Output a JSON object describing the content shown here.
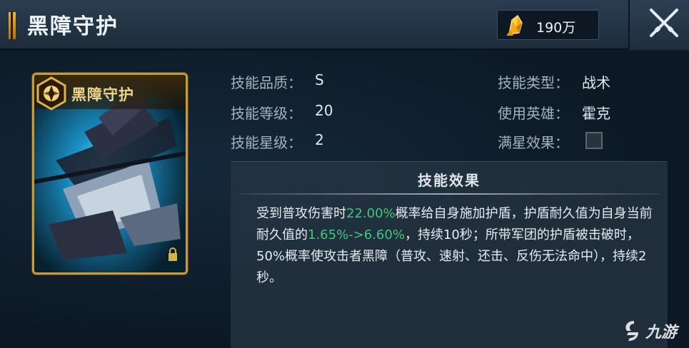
{
  "header": {
    "title": "黑障守护",
    "currency_icon": "gold-crystal-icon",
    "currency_value": "190万",
    "close_icon": "close-icon"
  },
  "card": {
    "title": "黑障守护",
    "badge_icon": "hexagon-aperture-icon",
    "art": "mech-wing-art",
    "lock_icon": "lock-icon"
  },
  "stats": {
    "quality_label": "技能品质：",
    "quality_value": "S",
    "level_label": "技能等级：",
    "level_value": "20",
    "star_label": "技能星级：",
    "star_value": "2",
    "type_label": "技能类型：",
    "type_value": "战术",
    "hero_label": "使用英雄：",
    "hero_value": "霍克",
    "fullstar_label": "满星效果："
  },
  "effect": {
    "title": "技能效果",
    "seg1": "受到普攻伤害时",
    "hl1": "22.00%",
    "seg2": "概率给自身施加护盾，护盾耐久值为自身当前耐久值的",
    "hl2": "1.65%->6.60%",
    "seg3": "，持续10秒；所带军团的护盾被击破时，50%概率使攻击者黑障（普攻、速射、还击、反伤无法命中），持续2秒。"
  },
  "watermark": {
    "text": "九游",
    "icon": "jiuyou-logo-icon"
  },
  "colors": {
    "highlight": "#3fc77a",
    "gold": "#c89a3e"
  }
}
